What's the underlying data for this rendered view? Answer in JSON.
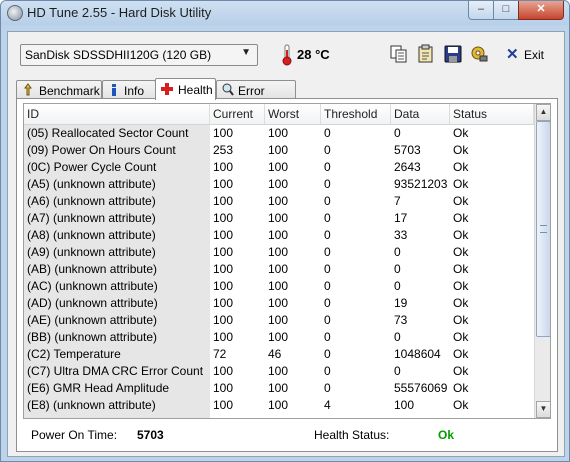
{
  "window": {
    "title": "HD Tune 2.55 - Hard Disk Utility",
    "minimize_glyph": "–",
    "maximize_glyph": "□",
    "close_glyph": "✕"
  },
  "toolbar": {
    "drive": "SanDisk SDSSDHII120G (120 GB)",
    "temperature": "28 °C",
    "exit_label": "Exit",
    "icons": [
      "copy-icon",
      "copy-text-icon",
      "save-icon",
      "options-icon",
      "exit-icon"
    ]
  },
  "tabs": [
    {
      "label": "Benchmark",
      "icon": "benchmark-icon"
    },
    {
      "label": "Info",
      "icon": "info-icon"
    },
    {
      "label": "Health",
      "icon": "health-cross-icon",
      "active": true
    },
    {
      "label": "Error Scan",
      "icon": "magnifier-icon"
    }
  ],
  "table": {
    "columns": [
      "ID",
      "Current",
      "Worst",
      "Threshold",
      "Data",
      "Status"
    ],
    "rows": [
      [
        "(05) Reallocated Sector Count",
        "100",
        "100",
        "0",
        "0",
        "Ok"
      ],
      [
        "(09) Power On Hours Count",
        "253",
        "100",
        "0",
        "5703",
        "Ok"
      ],
      [
        "(0C) Power Cycle Count",
        "100",
        "100",
        "0",
        "2643",
        "Ok"
      ],
      [
        "(A5) (unknown attribute)",
        "100",
        "100",
        "0",
        "93521203",
        "Ok"
      ],
      [
        "(A6) (unknown attribute)",
        "100",
        "100",
        "0",
        "7",
        "Ok"
      ],
      [
        "(A7) (unknown attribute)",
        "100",
        "100",
        "0",
        "17",
        "Ok"
      ],
      [
        "(A8) (unknown attribute)",
        "100",
        "100",
        "0",
        "33",
        "Ok"
      ],
      [
        "(A9) (unknown attribute)",
        "100",
        "100",
        "0",
        "0",
        "Ok"
      ],
      [
        "(AB) (unknown attribute)",
        "100",
        "100",
        "0",
        "0",
        "Ok"
      ],
      [
        "(AC) (unknown attribute)",
        "100",
        "100",
        "0",
        "0",
        "Ok"
      ],
      [
        "(AD) (unknown attribute)",
        "100",
        "100",
        "0",
        "19",
        "Ok"
      ],
      [
        "(AE) (unknown attribute)",
        "100",
        "100",
        "0",
        "73",
        "Ok"
      ],
      [
        "(BB) (unknown attribute)",
        "100",
        "100",
        "0",
        "0",
        "Ok"
      ],
      [
        "(C2) Temperature",
        "72",
        "46",
        "0",
        "1048604",
        "Ok"
      ],
      [
        "(C7) Ultra DMA CRC Error Count",
        "100",
        "100",
        "0",
        "0",
        "Ok"
      ],
      [
        "(E6) GMR Head Amplitude",
        "100",
        "100",
        "0",
        "55576069",
        "Ok"
      ],
      [
        "(E8) (unknown attribute)",
        "100",
        "100",
        "4",
        "100",
        "Ok"
      ]
    ]
  },
  "scrollbar": {
    "up_glyph": "▲",
    "down_glyph": "▼"
  },
  "status": {
    "power_on_label": "Power On Time:",
    "power_on_value": "5703",
    "health_label": "Health Status:",
    "health_value": "Ok",
    "health_color": "#00a000"
  }
}
